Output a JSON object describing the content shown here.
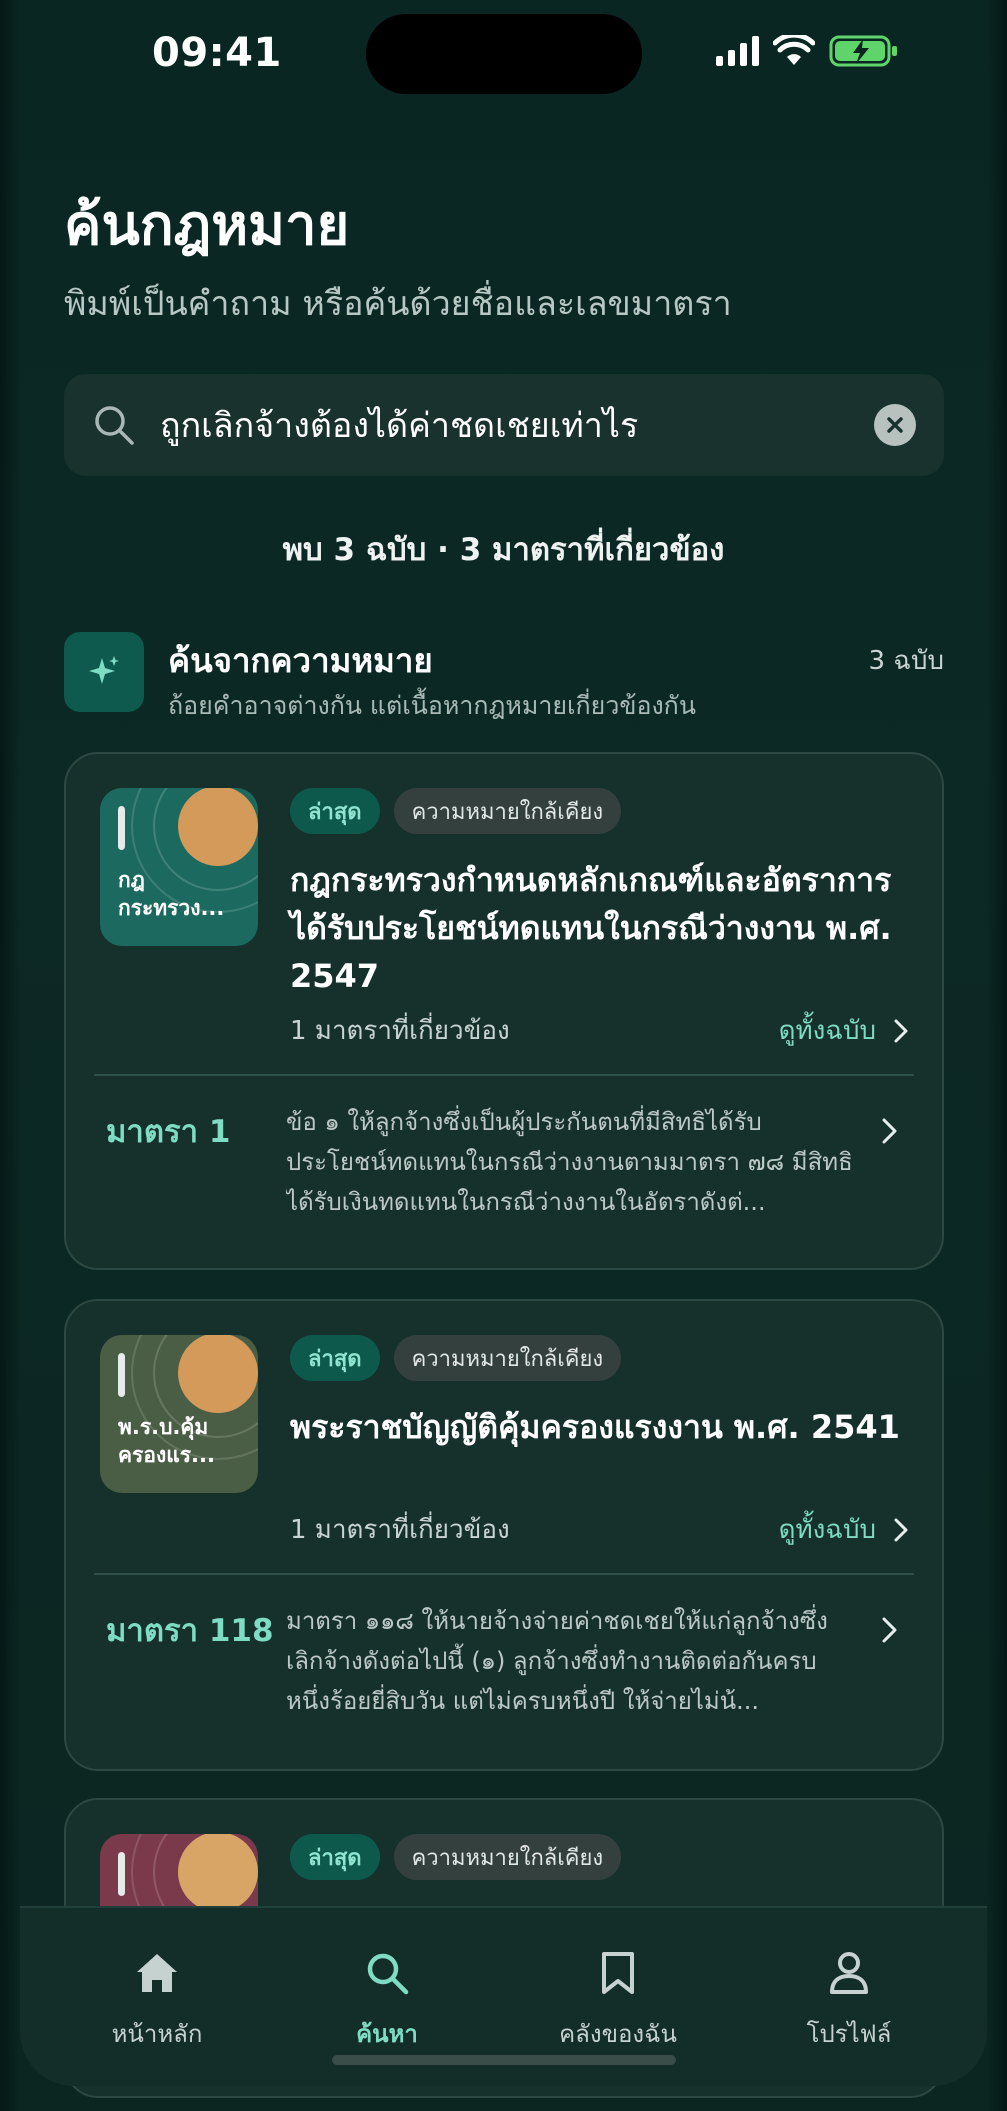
{
  "status": {
    "time": "09:41"
  },
  "header": {
    "title": "ค้นกฎหมาย",
    "subtitle": "พิมพ์เป็นคำถาม หรือค้นด้วยชื่อและเลขมาตรา"
  },
  "search": {
    "value": "ถูกเลิกจ้างต้องได้ค่าชดเชยเท่าไร",
    "icon": "search-icon"
  },
  "summary": "พบ 3 ฉบับ · 3 มาตราที่เกี่ยวข้อง",
  "section": {
    "title": "ค้นจากความหมาย",
    "desc": "ถ้อยคำอาจต่างกัน แต่เนื้อหากฎหมายเกี่ยวข้องกัน",
    "count": "3 ฉบับ"
  },
  "colors": {
    "accent": "#7fdcc4",
    "card": "#16302c",
    "background": "#0b2521"
  },
  "results": [
    {
      "thumb_label": "กฎ กระทรวง...",
      "thumb_color": "#1c6a5f",
      "chip_latest": "ล่าสุด",
      "chip_similar": "ความหมายใกล้เคียง",
      "title": "กฎกระทรวงกำหนดหลักเกณฑ์และอัตราการได้รับประโยชน์ทดแทนในกรณีว่างงาน พ.ศ. 2547",
      "meta": "1 มาตราที่เกี่ยวข้อง",
      "view_all": "ดูทั้งฉบับ",
      "section_no": "มาตรา 1",
      "section_text": "ข้อ ๑ ให้ลูกจ้างซึ่งเป็นผู้ประกันตนที่มีสิทธิได้รับประโยชน์ทดแทนในกรณีว่างงานตามมาตรา ๗๘ มีสิทธิได้รับเงินทดแทนในกรณีว่างงานในอัตราดังต่..."
    },
    {
      "thumb_label": "พ.ร.บ.คุ้ม ครองแร...",
      "thumb_color": "#4a5e45",
      "chip_latest": "ล่าสุด",
      "chip_similar": "ความหมายใกล้เคียง",
      "title": "พระราชบัญญัติคุ้มครองแรงงาน พ.ศ. 2541",
      "meta": "1 มาตราที่เกี่ยวข้อง",
      "view_all": "ดูทั้งฉบับ",
      "section_no": "มาตรา 118",
      "section_text": "มาตรา ๑๑๘ ให้นายจ้างจ่ายค่าชดเชยให้แก่ลูกจ้างซึ่งเลิกจ้างดังต่อไปนี้ (๑) ลูกจ้างซึ่งทำงานติดต่อกันครบหนึ่งร้อยยี่สิบวัน แต่ไม่ครบหนึ่งปี ให้จ่ายไม่น้..."
    },
    {
      "thumb_color": "#7a3a4c",
      "chip_latest": "ล่าสุด",
      "chip_similar": "ความหมายใกล้เคียง"
    }
  ],
  "nav": [
    {
      "label": "หน้าหลัก",
      "icon": "home-icon"
    },
    {
      "label": "ค้นหา",
      "icon": "search-icon"
    },
    {
      "label": "คลังของฉัน",
      "icon": "bookmark-icon"
    },
    {
      "label": "โปรไฟล์",
      "icon": "person-icon"
    }
  ]
}
